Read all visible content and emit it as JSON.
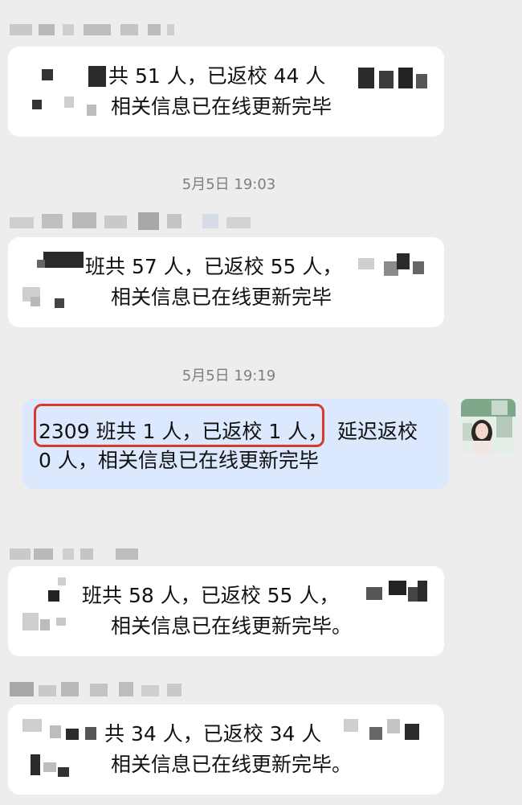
{
  "messages": [
    {
      "line1": "共 51 人，已返校 44 人",
      "line2": "相关信息已在线更新完毕"
    },
    {
      "line1": "班共 57 人，已返校 55 人，",
      "line2": "相关信息已在线更新完毕"
    },
    {
      "line1_highlight": "2309 班共 1 人，已返校 1 人，",
      "line1_rest": "延迟返校",
      "line2": "0 人，相关信息已在线更新完毕"
    },
    {
      "line1": "班共 58 人，已返校 55 人，",
      "line2": "相关信息已在线更新完毕。"
    },
    {
      "line1": "共 34 人，已返校 34 人",
      "line2": "相关信息已在线更新完毕。"
    }
  ],
  "timestamps": [
    "5月5日 19:03",
    "5月5日 19:19"
  ],
  "icons": {
    "avatar": "user-avatar-photo"
  },
  "colors": {
    "highlight_border": "#d93a2b",
    "own_bubble": "#dce8fd",
    "background": "#ededed"
  }
}
